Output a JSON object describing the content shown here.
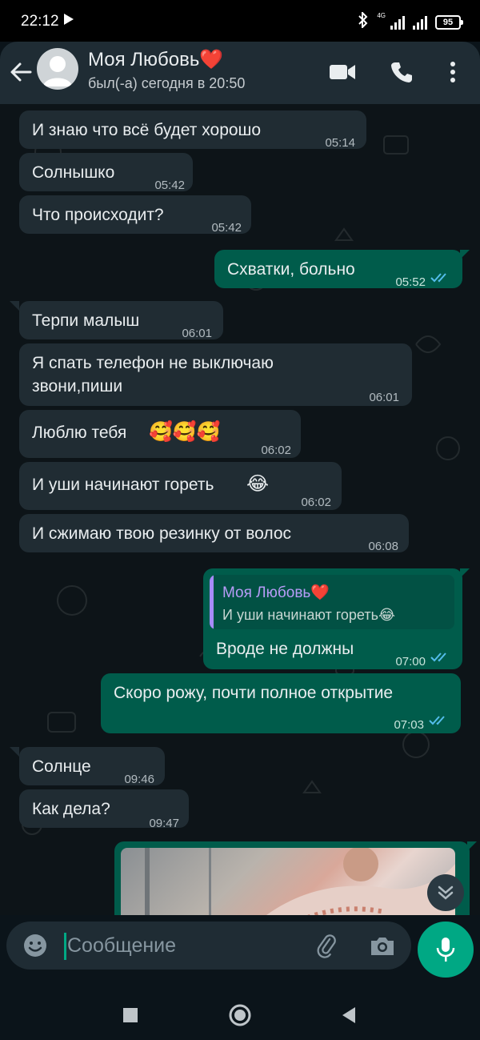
{
  "status_bar": {
    "time": "22:12",
    "network": "4G",
    "battery": "95"
  },
  "header": {
    "contact_name": "Моя Любовь❤️",
    "last_seen": "был(-а) сегодня в 20:50"
  },
  "messages": [
    {
      "dir": "in",
      "text": "И знаю что всё будет хорошо",
      "time": "05:14"
    },
    {
      "dir": "in",
      "text": "Солнышко",
      "time": "05:42"
    },
    {
      "dir": "in",
      "text": "Что происходит?",
      "time": "05:42"
    },
    {
      "dir": "out",
      "text": "Схватки, больно",
      "time": "05:52",
      "read": true
    },
    {
      "dir": "in",
      "text": "Терпи малыш",
      "time": "06:01"
    },
    {
      "dir": "in",
      "text_line1": "Я спать телефон не выключаю",
      "text_line2": "звони,пиши",
      "time": "06:01"
    },
    {
      "dir": "in",
      "text": "Люблю тебя",
      "emoji": "🥰🥰🥰",
      "time": "06:02"
    },
    {
      "dir": "in",
      "text": "И уши начинают гореть",
      "emoji": "😂",
      "time": "06:02"
    },
    {
      "dir": "in",
      "text": "И сжимаю твою резинку от волос",
      "time": "06:08"
    },
    {
      "dir": "out",
      "quote_name": "Моя Любовь❤️",
      "quote_text": "И уши начинают гореть😂",
      "text": "Вроде не должны",
      "time": "07:00",
      "read": true
    },
    {
      "dir": "out",
      "text": "Скоро рожу, почти полное открытие",
      "time": "07:03",
      "read": true
    },
    {
      "dir": "in",
      "text": "Солнце",
      "time": "09:46"
    },
    {
      "dir": "in",
      "text": "Как дела?",
      "time": "09:47"
    }
  ],
  "composer": {
    "placeholder": "Сообщение"
  },
  "icons": {
    "back": "arrow-left-icon",
    "video": "video-call-icon",
    "call": "phone-icon",
    "menu": "more-vertical-icon",
    "emoji": "emoji-icon",
    "attach": "paperclip-icon",
    "camera": "camera-icon",
    "mic": "mic-icon",
    "scroll": "double-chevron-down-icon"
  },
  "colors": {
    "incoming_bubble": "#202c33",
    "outgoing_bubble": "#005c4b",
    "accent": "#00a884",
    "read_ticks": "#53bdeb"
  }
}
